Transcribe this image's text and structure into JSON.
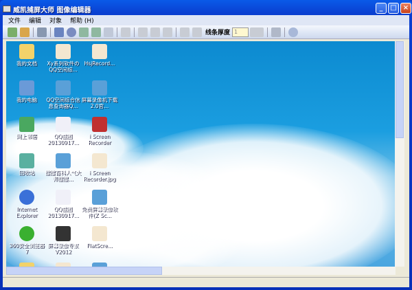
{
  "window": {
    "title": "威凯捕屏大师 图像编辑器",
    "min": "_",
    "max": "□",
    "close": "×"
  },
  "menu": [
    "文件",
    "编辑",
    "对象",
    "帮助 (H)"
  ],
  "toolbar": {
    "line_width_label": "线条厚度",
    "line_width_value": "1"
  },
  "desktop_icons": [
    {
      "label": "我的文档",
      "type": "folder"
    },
    {
      "label": "Xy系列软件の QQ空间综...",
      "type": "doc"
    },
    {
      "label": "HsjRecord...",
      "type": "doc"
    },
    {
      "label": "我的电脑",
      "type": "pc"
    },
    {
      "label": "QQ空间综合信息查询器Q...",
      "type": "p6"
    },
    {
      "label": "屏幕录像机下载 2.0官...",
      "type": "p6"
    },
    {
      "label": "网上邻居",
      "type": "net"
    },
    {
      "label": "QQ截图 20130917...",
      "type": "img"
    },
    {
      "label": "i Screen Recorder",
      "type": "rec"
    },
    {
      "label": "回收站",
      "type": "bin"
    },
    {
      "label": "搜搜百科人气大师搜搜...",
      "type": "p6"
    },
    {
      "label": "i Screen Recorder.jpg",
      "type": "doc"
    },
    {
      "label": "Internet Explorer",
      "type": "ie"
    },
    {
      "label": "QQ截图 20130917...",
      "type": "img"
    },
    {
      "label": "免费屏幕录像软件(Z Sc...",
      "type": "p6"
    },
    {
      "label": "360安全浏览器7",
      "type": "b360"
    },
    {
      "label": "屏幕录像专家 V2012",
      "type": "film"
    },
    {
      "label": "FlatScre...",
      "type": "doc"
    },
    {
      "label": "",
      "type": "folder"
    },
    {
      "label": "",
      "type": "doc"
    },
    {
      "label": "",
      "type": "p6"
    }
  ],
  "scroll": {
    "vertical_thumb_fraction": 0.43,
    "horizontal_thumb_fraction": 0.4
  },
  "colors": {
    "titlebar": "#0a5ae8",
    "close": "#c9421a"
  }
}
